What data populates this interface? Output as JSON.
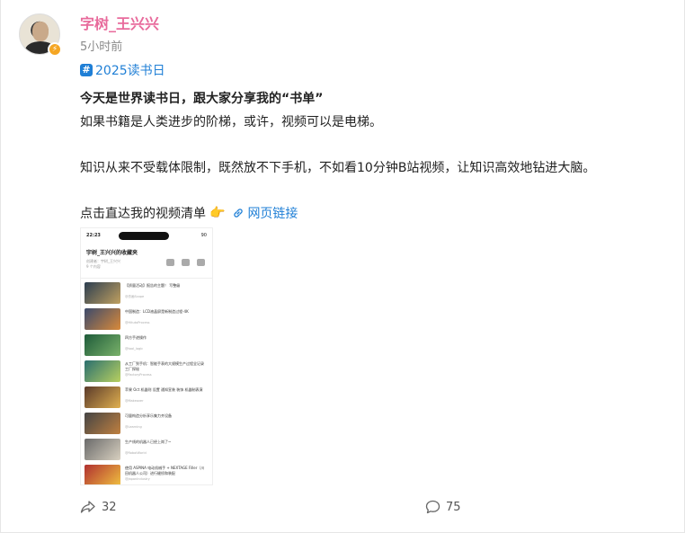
{
  "author": {
    "name": "字树_王兴兴",
    "time": "5小时前",
    "badge_icon": "verified-lightning-icon"
  },
  "topic": {
    "label": "2025读书日"
  },
  "post": {
    "headline": "今天是世界读书日，跟大家分享我的“书单”",
    "line2": "如果书籍是人类进步的阶梯，或许，视频可以是电梯。",
    "line3": "知识从来不受载体限制，既然放不下手机，不如看10分钟B站视频，让知识高效地钻进大脑。",
    "cta": "点击直达我的视频清单",
    "link_label": "网页链接"
  },
  "screenshot": {
    "clock": "22:23",
    "signal": "90",
    "title": "宇树_王兴兴的收藏夹",
    "meta": "创建者：宇树_王兴兴",
    "meta2": "9 个内容",
    "items": [
      {
        "title": "【质量活动】报告的主题！ 写整级",
        "sub": "@仿画Scope"
      },
      {
        "title": "中国制造：LCD液晶屏是新制造过程-4K",
        "sub": "@HitutoProcess"
      },
      {
        "title": "四方手迹操作",
        "sub": "@tool_logic"
      },
      {
        "title": "从工厂到手机：智能手表的大规模生产过程全记录 工厂探秘",
        "sub": "@FactoryProcess"
      },
      {
        "title": "苹果 Oct 机器则 设置 通知宣装 装饰 机器制表演",
        "sub": "@Makeover"
      },
      {
        "title": "可量构造分析享乐集力齐设备",
        "sub": "@Learning"
      },
      {
        "title": "生产线的机器人已经上岗了~",
        "sub": "@RobotWorld"
      },
      {
        "title": "使用 ASPINA 电动机械手 + NEXTAGE Filler（川田机器人公司）进行缝纫和装配",
        "sub": "@JapanIndustry"
      }
    ]
  },
  "footer": {
    "shares": "32",
    "comments": "75"
  }
}
